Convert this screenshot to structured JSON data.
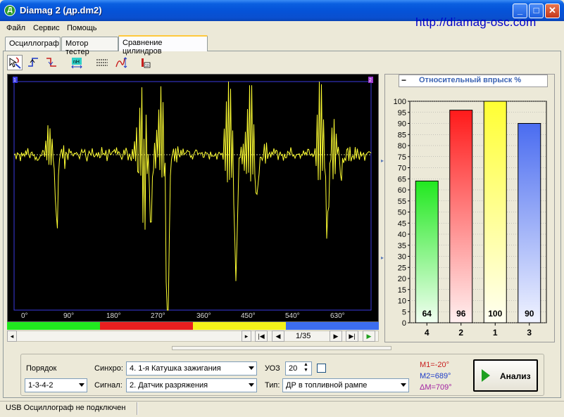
{
  "window": {
    "title": "Diamag 2 (др.dm2)",
    "app_icon_glyph": "Д"
  },
  "site_url": "http://diamag-osc.com",
  "menu": [
    "Файл",
    "Сервис",
    "Помощь"
  ],
  "tabs": [
    "Осциллограф",
    "Мотор тестер",
    "Сравнение цилиндров"
  ],
  "active_tab": "Сравнение цилиндров",
  "toolbar_icons": [
    "cursor-pick-icon",
    "sync-edge-up-icon",
    "sync-edge-down-icon",
    "timebase-icon",
    "grid-lines-icon",
    "amplitude-scale-icon",
    "level-meter-icon"
  ],
  "scope": {
    "channel_markers": [
      "1",
      "2"
    ],
    "degree_labels": [
      "0°",
      "90°",
      "180°",
      "270°",
      "360°",
      "450°",
      "540°",
      "630°"
    ],
    "cylinder_colors": [
      "#21e81f",
      "#e81f1f",
      "#f4f21a",
      "#3c6df0"
    ],
    "frame_counter": "1/35",
    "trace_color": "#ffff33"
  },
  "chart": {
    "title": "Относительный впрыск %",
    "collapse_glyph": "−"
  },
  "chart_data": {
    "type": "bar",
    "title": "Относительный впрыск %",
    "categories": [
      "4",
      "2",
      "1",
      "3"
    ],
    "values": [
      64,
      96,
      100,
      90
    ],
    "colors": [
      "#21e81f",
      "#ff1a1a",
      "#ffff33",
      "#4a6cf0"
    ],
    "ylim": [
      0,
      100
    ],
    "yticks": [
      0,
      5,
      10,
      15,
      20,
      25,
      30,
      35,
      40,
      45,
      50,
      55,
      60,
      65,
      70,
      75,
      80,
      85,
      90,
      95,
      100
    ],
    "grid": true
  },
  "controls": {
    "order_label": "Порядок",
    "order_value": "1-3-4-2",
    "sync_label": "Синхро:",
    "sync_value": "4.  1-я Катушка зажигания",
    "signal_label": "Сигнал:",
    "signal_value": "2.  Датчик разряжения",
    "uoz_label": "УОЗ",
    "uoz_value": "20",
    "type_label": "Тип:",
    "type_value": "ДР в топливной рампе",
    "m1": "M1=-20°",
    "m2": "M2=689°",
    "dm": "ΔM=709°",
    "m1_color": "#c81e1e",
    "m2_color": "#1e3cc8",
    "dm_color": "#a01ea0",
    "analyze_label": "Анализ"
  },
  "status": {
    "text": "USB Осциллограф не подключен"
  }
}
